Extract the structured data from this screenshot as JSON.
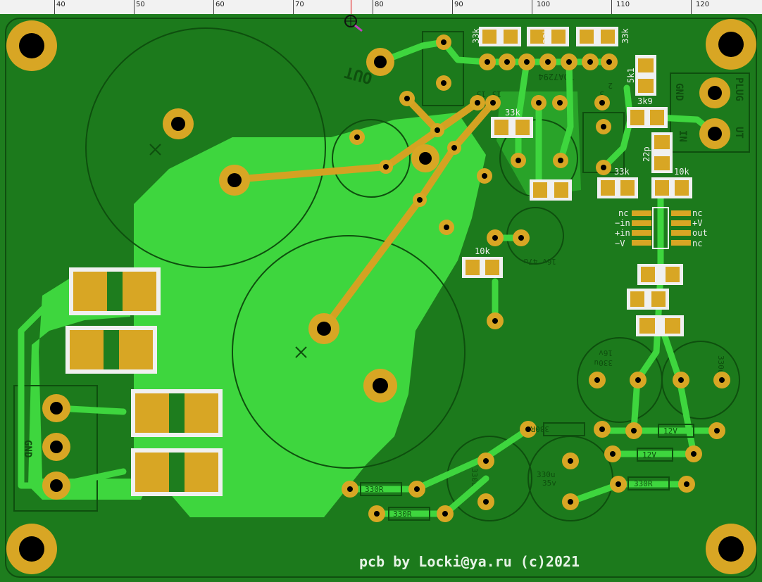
{
  "ruler": {
    "labels": [
      "40",
      "50",
      "60",
      "70",
      "80",
      "90",
      "100",
      "110",
      "120"
    ]
  },
  "credit": "pcb by Locki@ya.ru (c)2021",
  "colors": {
    "board": "#1e7d1e",
    "pour": "#2fa82f",
    "copper_light": "#3ed63e",
    "trace": "#d4a222",
    "pad": "#d8a624",
    "silk": "#f0f0f0",
    "dark_silk": "#0e4f0e"
  },
  "labels": {
    "out": "OUT",
    "gnd_left": "GND",
    "gnd_right": "GND",
    "plug": "PLUG",
    "in": "IN",
    "ut": "UT",
    "r33k_1": "33k",
    "r33k_2": "33k",
    "r33k_3": "33k",
    "r33k_4": "33k",
    "r33k_5": "33k",
    "r5k1": "5k1",
    "r3k9": "3k9",
    "c22p": "22p",
    "r10k_1": "10k",
    "r10k_2": "10k",
    "ic_nc1": "nc",
    "ic_in_minus": "−in",
    "ic_in_plus": "+in",
    "ic_v_minus": "−V",
    "ic_nc2": "nc",
    "ic_v_plus": "+V",
    "ic_out": "out",
    "ic_nc3": "nc",
    "c330u_1": "330u",
    "c330u_2": "330u",
    "c330u_3": "330u",
    "c330u_4": "330u",
    "v16": "16v",
    "v35": "35v",
    "r330_1": "330R",
    "r330_2": "330R",
    "r330_3": "330R",
    "r330_4": "330R",
    "z12v_1": "12V",
    "z12v_2": "12V",
    "cap_47u": "16v 47u",
    "tda": "TDA7294",
    "pin2": "2",
    "pin3": "3",
    "pin15": "15",
    "pin13": "13"
  }
}
